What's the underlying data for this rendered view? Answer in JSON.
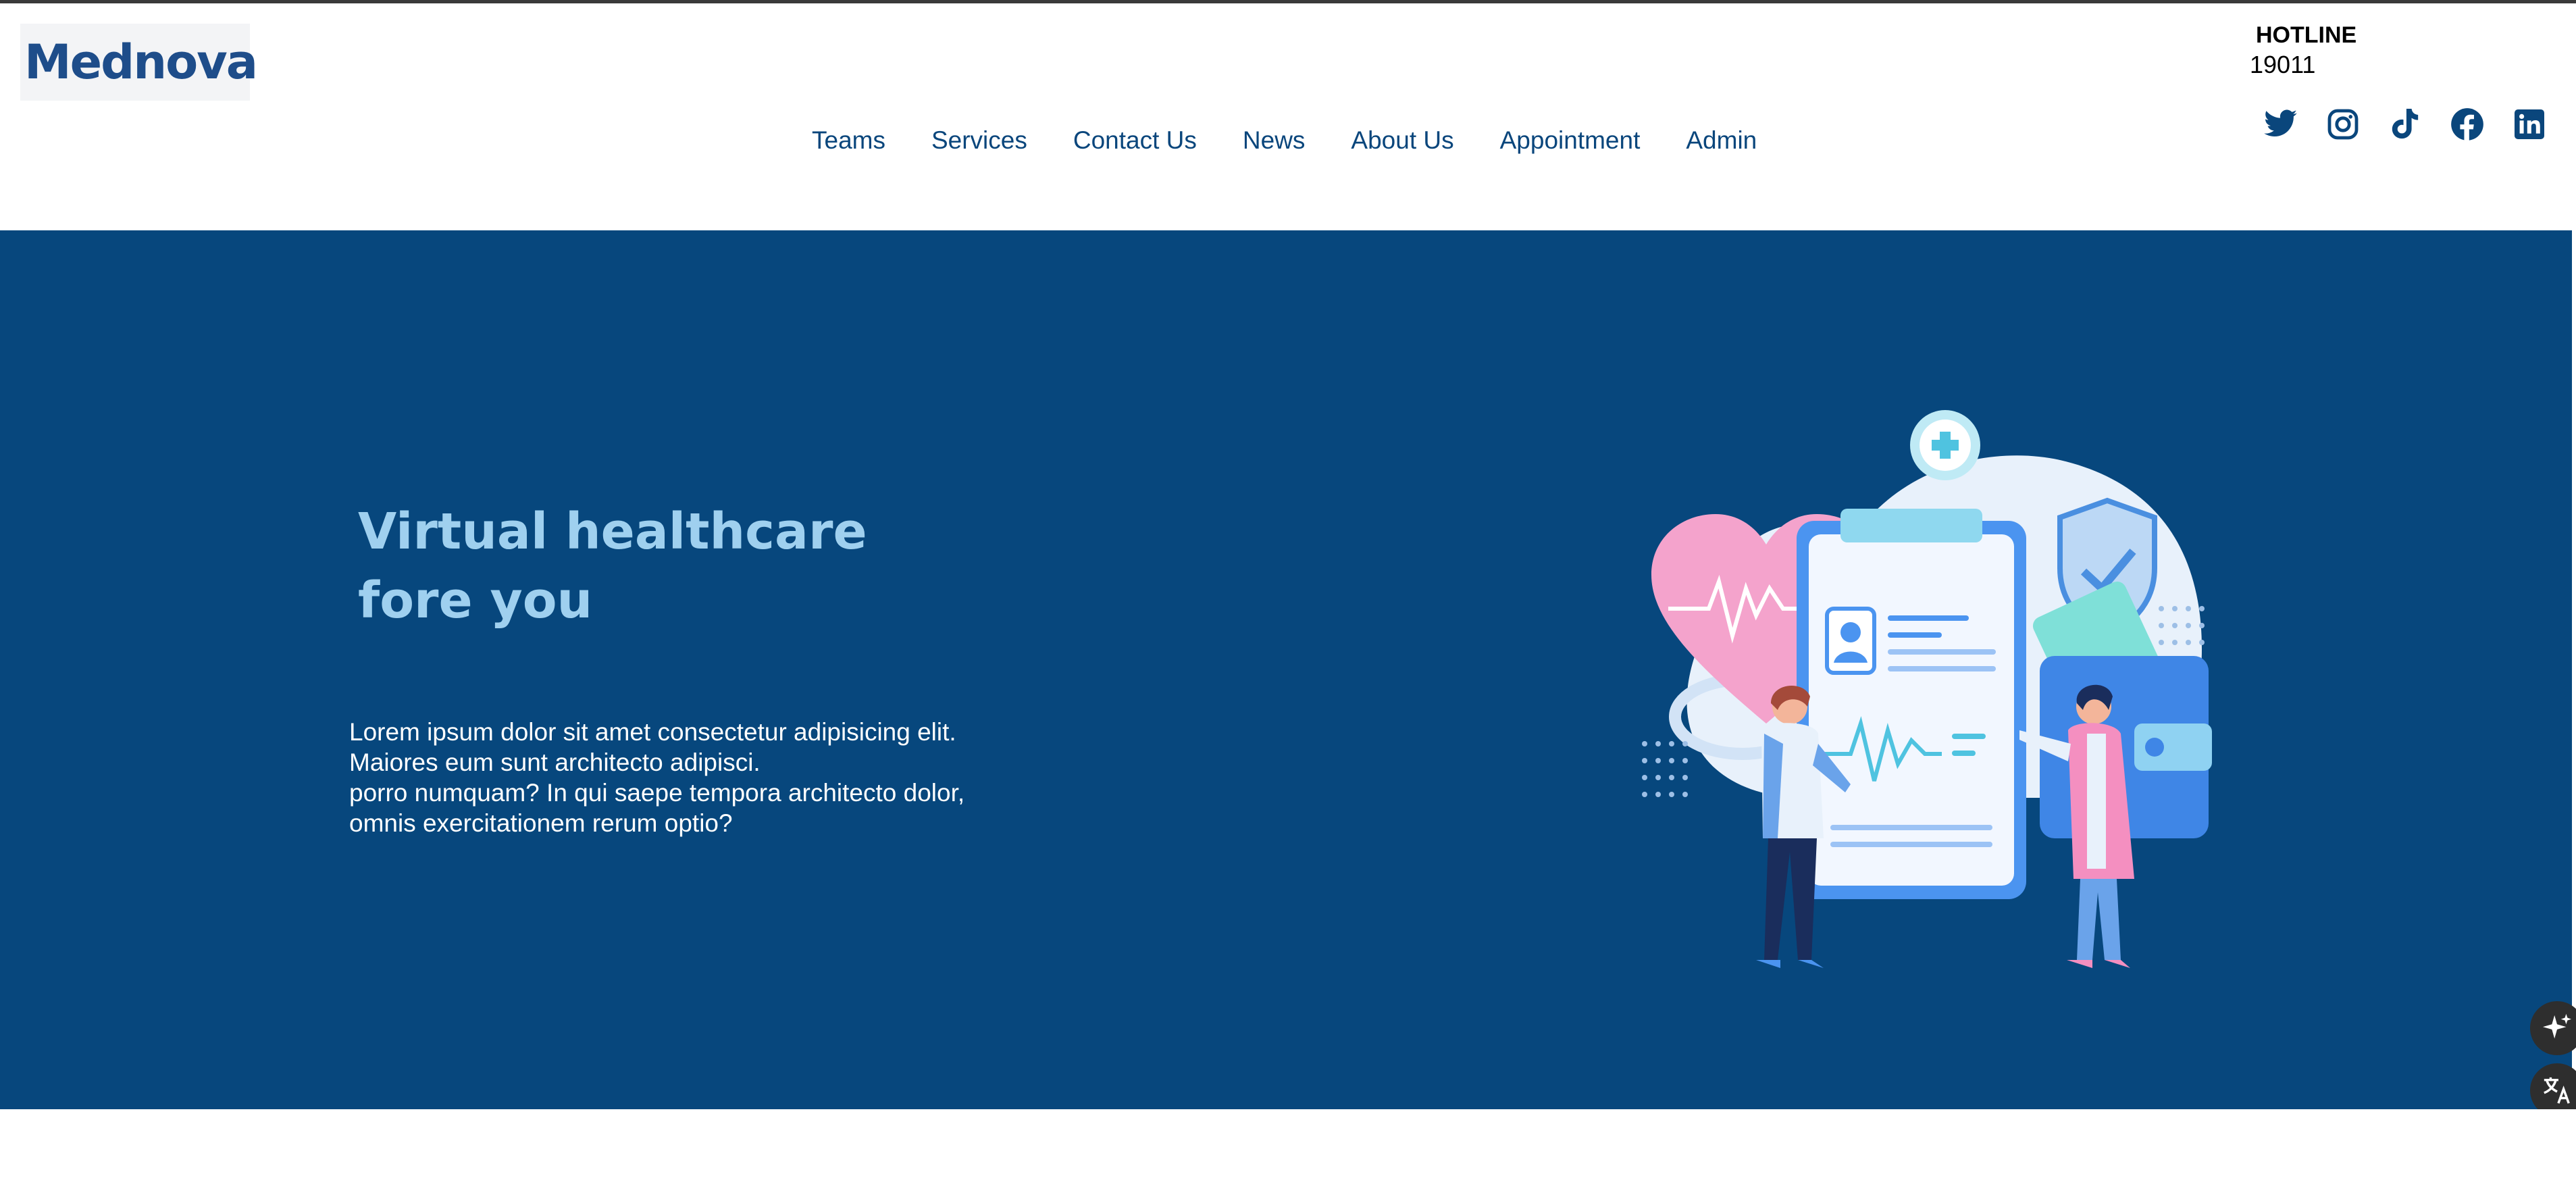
{
  "brand": {
    "name": "Mednova",
    "logo_icon": "heart-pulse-icon",
    "color": "#1e4d8a"
  },
  "nav": {
    "items": [
      {
        "label": "Teams"
      },
      {
        "label": "Services"
      },
      {
        "label": "Contact Us"
      },
      {
        "label": "News"
      },
      {
        "label": "About Us"
      },
      {
        "label": "Appointment"
      },
      {
        "label": "Admin"
      }
    ]
  },
  "hotline": {
    "label": "HOTLINE",
    "number": "19011"
  },
  "socials": [
    {
      "icon": "twitter-icon"
    },
    {
      "icon": "instagram-icon"
    },
    {
      "icon": "tiktok-icon"
    },
    {
      "icon": "facebook-icon"
    },
    {
      "icon": "linkedin-icon"
    }
  ],
  "hero": {
    "title_line1": "Virtual healthcare",
    "title_line2": "fore you",
    "text_lines": [
      "Lorem ipsum dolor sit amet consectetur adipisicing elit.",
      "Maiores eum sunt architecto adipisci.",
      "porro numquam? In qui saepe tempora architecto dolor,",
      "omnis exercitationem rerum optio?"
    ],
    "background": "#07477d",
    "title_color": "#9fd0ef"
  },
  "floating_buttons": [
    {
      "icon": "sparkle-icon"
    },
    {
      "icon": "translate-icon"
    }
  ],
  "colors": {
    "nav_text": "#0a467c",
    "icon": "#0a467c"
  }
}
